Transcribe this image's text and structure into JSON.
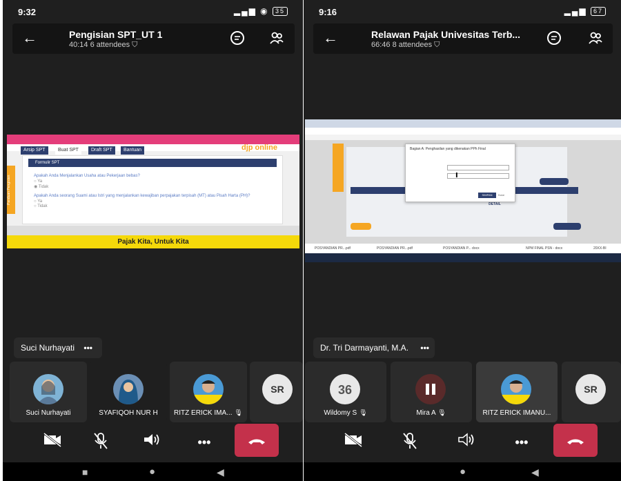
{
  "left": {
    "status": {
      "time": "9:32",
      "icons": "⚲ ✆",
      "signal": "▂▄▆",
      "battery": "35"
    },
    "meeting": {
      "title": "Pengisian SPT_UT 1",
      "subtitle": "40:14  6 attendees"
    },
    "share": {
      "tabs": [
        "Arsip SPT",
        "Buat SPT",
        "Draft SPT",
        "Bantuan"
      ],
      "header": "Formulir SPT",
      "question1": "Apakah Anda Menjalankan Usaha atau Pekerjaan bebas?",
      "question2": "Apakah Anda seorang Suami atau Istri yang menjalankan kewajiban perpajakan terpisah (MT) atau Pisah Harta (PH)?",
      "opt_yes": "Ya",
      "opt_no": "Tidak",
      "side_label": "Panduan Pengisian",
      "logo": "djp online",
      "banner": "Pajak Kita, Untuk Kita"
    },
    "active_speaker": "Suci Nurhayati",
    "more": "•••",
    "participants": [
      {
        "name": "Suci Nurhayati"
      },
      {
        "name": "SYAFIQOH NUR H"
      },
      {
        "name": "RITZ ERICK IMA..."
      },
      {
        "name": "SR",
        "initials": "SR"
      }
    ]
  },
  "right": {
    "status": {
      "time": "9:16",
      "icons": "✆",
      "signal": "▂▄▆",
      "battery": "67"
    },
    "meeting": {
      "title": "Relawan Pajak Univesitas Terb...",
      "subtitle": "66:46  8 attendees"
    },
    "share": {
      "dialog_title": "Bagian A: Penghasilan yang dikenakan PPh Final",
      "dialog_button": "SIMPAN",
      "dialog_cancel": "Batal",
      "taskbar_items": [
        "POSYANDIAN PR...pdf",
        "POSYANDIAN PR...pdf",
        "POSYANDIAN P... docx",
        "NPM FINAL PSN - docx",
        "20XX-BI"
      ],
      "banner_label": "DETAIL"
    },
    "active_speaker": "Dr. Tri Darmayanti, M.A.",
    "more": "•••",
    "participants": [
      {
        "name": "Wildomy S"
      },
      {
        "name": "Mira A"
      },
      {
        "name": "RITZ ERICK IMANU..."
      },
      {
        "name": "SR",
        "initials": "SR"
      }
    ]
  },
  "colors": {
    "end_call": "#c4314b",
    "tile_bg": "#2b2b2b",
    "banner": "#f5d90a"
  }
}
